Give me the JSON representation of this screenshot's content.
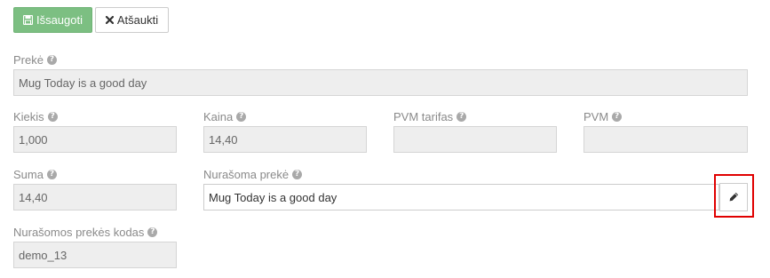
{
  "toolbar": {
    "save_label": "Išsaugoti",
    "cancel_label": "Atšaukti"
  },
  "form": {
    "product": {
      "label": "Prekė",
      "value": "Mug Today is a good day"
    },
    "quantity": {
      "label": "Kiekis",
      "value": "1,000"
    },
    "price": {
      "label": "Kaina",
      "value": "14,40"
    },
    "vat_rate": {
      "label": "PVM tarifas",
      "value": ""
    },
    "vat": {
      "label": "PVM",
      "value": ""
    },
    "sum": {
      "label": "Suma",
      "value": "14,40"
    },
    "written_off_product": {
      "label": "Nurašoma prekė",
      "value": "Mug Today is a good day"
    },
    "written_off_product_code": {
      "label": "Nurašomos prekės kodas",
      "value": "demo_13"
    }
  },
  "help_glyph": "?",
  "colors": {
    "save_button": "#7cbf82",
    "highlight": "#e00000",
    "readonly_field": "#eeeeee"
  },
  "icons": {
    "save": "floppy-disk-icon",
    "cancel": "close-icon",
    "edit": "pencil-icon",
    "help": "question-circle-icon"
  }
}
